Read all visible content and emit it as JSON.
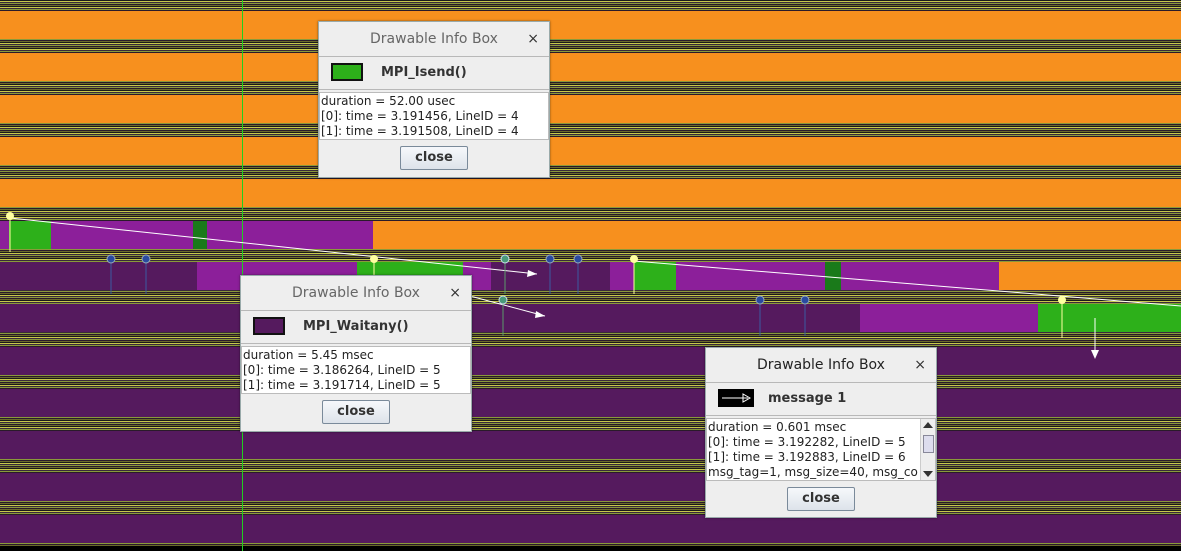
{
  "colors": {
    "orange": "#f7901e",
    "purple": "#8c1f9a",
    "dark_purple": "#551a5e",
    "green": "#2db01a",
    "dark_green": "#1a7a1a",
    "cursor": "#1fd01f"
  },
  "dialogs": {
    "isend": {
      "title": "Drawable Info Box",
      "close_x": "×",
      "name": "MPI_Isend()",
      "swatch_color": "#2db01a",
      "lines": [
        "duration = 52.00 usec",
        "[0]: time = 3.191456, LineID = 4",
        "[1]: time = 3.191508, LineID = 4"
      ],
      "close_label": "close"
    },
    "waitany": {
      "title": "Drawable Info Box",
      "close_x": "×",
      "name": "MPI_Waitany()",
      "swatch_color": "#551a5e",
      "lines": [
        "duration = 5.45 msec",
        "[0]: time = 3.186264, LineID = 5",
        "[1]: time = 3.191714, LineID = 5"
      ],
      "close_label": "close"
    },
    "message": {
      "title": "Drawable Info Box",
      "close_x": "×",
      "name": "message 1",
      "swatch_color": "#000000",
      "lines": [
        "duration = 0.601 msec",
        "[0]: time = 3.192282, LineID = 5",
        "[1]: time = 3.192883, LineID = 6",
        "msg_tag=1, msg_size=40, msg_co"
      ],
      "close_label": "close"
    }
  }
}
